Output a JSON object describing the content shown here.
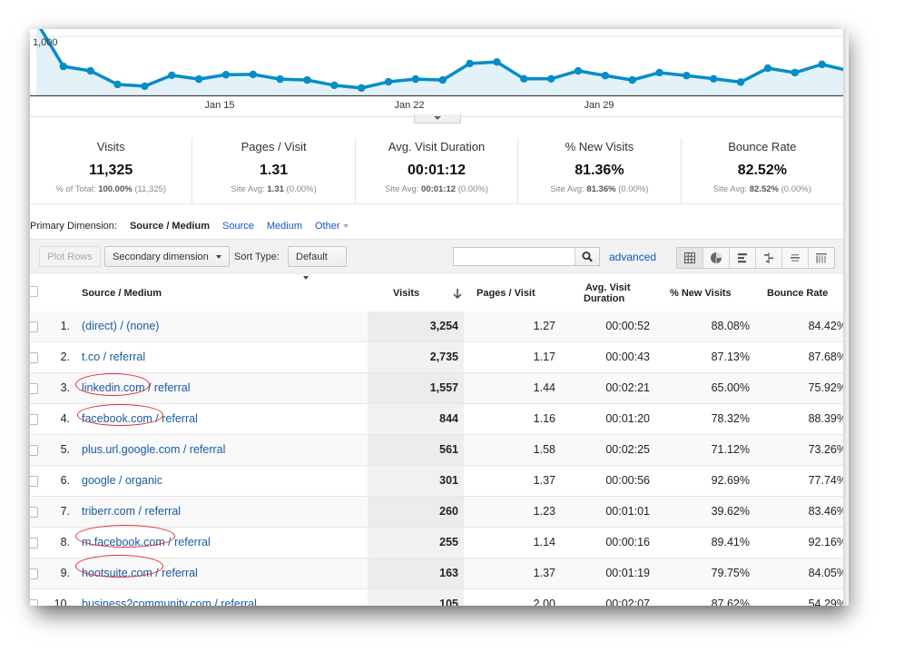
{
  "chart_data": {
    "type": "area",
    "title": "",
    "series": [
      {
        "name": "Visits",
        "color": "#058dc7",
        "values": [
          1250,
          490,
          415,
          185,
          155,
          340,
          275,
          350,
          355,
          275,
          260,
          170,
          125,
          230,
          275,
          260,
          540,
          565,
          280,
          280,
          415,
          335,
          260,
          385,
          335,
          280,
          225,
          460,
          385,
          525,
          415
        ]
      }
    ],
    "x_tick_labels": [
      {
        "label": "Jan 15",
        "index": 7
      },
      {
        "label": "Jan 22",
        "index": 14
      },
      {
        "label": "Jan 29",
        "index": 21
      }
    ],
    "y_tick_labels": [
      "1,000"
    ],
    "ylim": [
      0,
      1000
    ],
    "grid": true
  },
  "scorecards": [
    {
      "title": "Visits",
      "value": "11,325",
      "sub_label": "% of Total:",
      "sub_value": "100.00%",
      "sub_extra": "(11,325)"
    },
    {
      "title": "Pages / Visit",
      "value": "1.31",
      "sub_label": "Site Avg:",
      "sub_value": "1.31",
      "sub_extra": "(0.00%)"
    },
    {
      "title": "Avg. Visit Duration",
      "value": "00:01:12",
      "sub_label": "Site Avg:",
      "sub_value": "00:01:12",
      "sub_extra": "(0.00%)"
    },
    {
      "title": "% New Visits",
      "value": "81.36%",
      "sub_label": "Site Avg:",
      "sub_value": "81.36%",
      "sub_extra": "(0.00%)"
    },
    {
      "title": "Bounce Rate",
      "value": "82.52%",
      "sub_label": "Site Avg:",
      "sub_value": "82.52%",
      "sub_extra": "(0.00%)"
    }
  ],
  "primary_dimension": {
    "label": "Primary Dimension:",
    "current": "Source / Medium",
    "options": [
      "Source",
      "Medium",
      "Other"
    ]
  },
  "toolbar": {
    "plot_rows": "Plot Rows",
    "secondary_dimension": "Secondary dimension",
    "sort_type_label": "Sort Type:",
    "sort_type_value": "Default",
    "search_value": "",
    "advanced": "advanced",
    "views": [
      "table-view-icon",
      "pie-view-icon",
      "bar-view-icon",
      "comparison-view-icon",
      "term-cloud-icon",
      "pivot-view-icon"
    ]
  },
  "table": {
    "headers": {
      "source": "Source / Medium",
      "visits": "Visits",
      "pages": "Pages / Visit",
      "duration_1": "Avg. Visit",
      "duration_2": "Duration",
      "new_visits": "% New Visits",
      "bounce": "Bounce Rate"
    },
    "rows": [
      {
        "n": "1.",
        "source": "(direct) / (none)",
        "visits": "3,254",
        "pages": "1.27",
        "duration": "00:00:52",
        "new_visits": "88.08%",
        "bounce": "84.42%"
      },
      {
        "n": "2.",
        "source": "t.co / referral",
        "visits": "2,735",
        "pages": "1.17",
        "duration": "00:00:43",
        "new_visits": "87.13%",
        "bounce": "87.68%"
      },
      {
        "n": "3.",
        "source": "linkedin.com / referral",
        "visits": "1,557",
        "pages": "1.44",
        "duration": "00:02:21",
        "new_visits": "65.00%",
        "bounce": "75.92%"
      },
      {
        "n": "4.",
        "source": "facebook.com / referral",
        "visits": "844",
        "pages": "1.16",
        "duration": "00:01:20",
        "new_visits": "78.32%",
        "bounce": "88.39%"
      },
      {
        "n": "5.",
        "source": "plus.url.google.com / referral",
        "visits": "561",
        "pages": "1.58",
        "duration": "00:02:25",
        "new_visits": "71.12%",
        "bounce": "73.26%"
      },
      {
        "n": "6.",
        "source": "google / organic",
        "visits": "301",
        "pages": "1.37",
        "duration": "00:00:56",
        "new_visits": "92.69%",
        "bounce": "77.74%"
      },
      {
        "n": "7.",
        "source": "triberr.com / referral",
        "visits": "260",
        "pages": "1.23",
        "duration": "00:01:01",
        "new_visits": "39.62%",
        "bounce": "83.46%"
      },
      {
        "n": "8.",
        "source": "m.facebook.com / referral",
        "visits": "255",
        "pages": "1.14",
        "duration": "00:00:16",
        "new_visits": "89.41%",
        "bounce": "92.16%"
      },
      {
        "n": "9.",
        "source": "hootsuite.com / referral",
        "visits": "163",
        "pages": "1.37",
        "duration": "00:01:19",
        "new_visits": "79.75%",
        "bounce": "84.05%"
      },
      {
        "n": "10.",
        "source": "business2community.com / referral",
        "visits": "105",
        "pages": "2.00",
        "duration": "00:02:07",
        "new_visits": "87.62%",
        "bounce": "54.29%"
      }
    ]
  },
  "annotations": {
    "circled_rows": [
      "linkedin.com",
      "facebook.com",
      "m.facebook.com",
      "hootsuite.com"
    ],
    "circle_color": "#d9333a"
  }
}
